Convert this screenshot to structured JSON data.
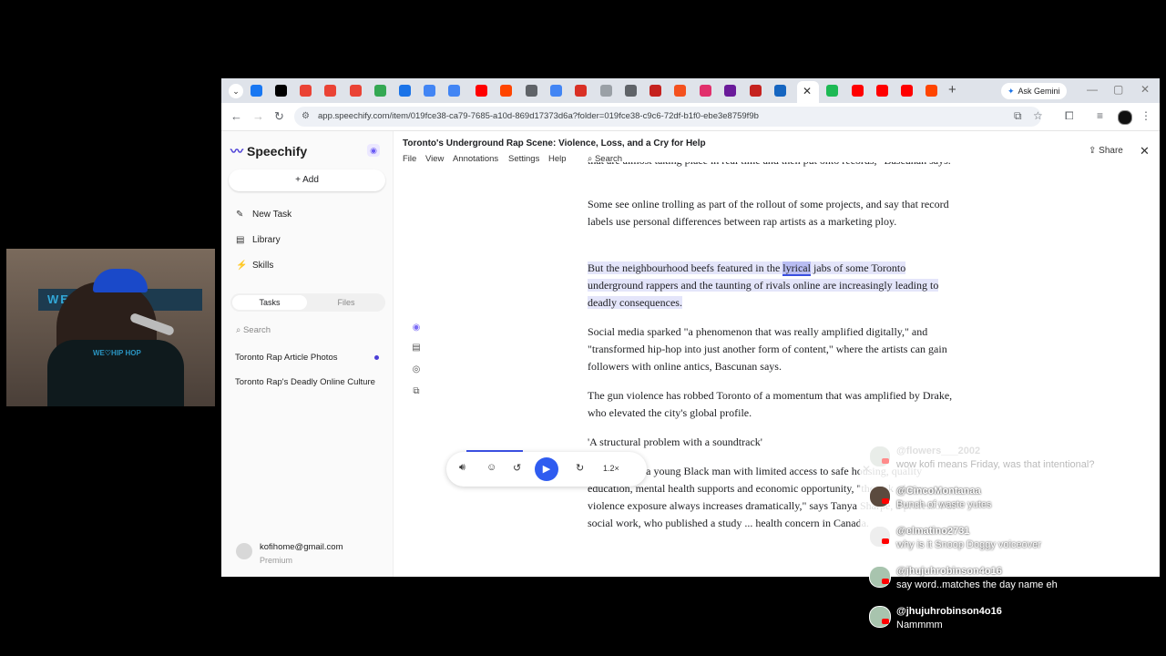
{
  "browser": {
    "tab_colors": [
      "#1877f2",
      "#000000",
      "#ea4335",
      "#ea4335",
      "#ea4335",
      "#34a853",
      "#1a73e8",
      "#4285f4",
      "#4285f4",
      "#ff0000",
      "#ff4500",
      "#5f6368",
      "#4285f4",
      "#d93025",
      "#9aa0a6",
      "#5f6368",
      "#c5221f",
      "#f4511e",
      "#e1306c",
      "#6a1b9a",
      "#c5221f",
      "#1565c0",
      "#1db954",
      "#ff0000",
      "#ff0000",
      "#ff0000",
      "#ff4500"
    ],
    "active_tab_close": "✕",
    "new_tab": "+",
    "ask_gemini": "Ask Gemini",
    "url": "app.speechify.com/item/019fce38-ca79-7685-a10d-869d17373d6a?folder=019fce38-c9c6-72df-b1f0-ebe3e8759f9b",
    "controls": {
      "minimize": "—",
      "maximize": "▢",
      "close": "✕"
    },
    "nav": {
      "back": "←",
      "forward": "→",
      "reload": "↻"
    }
  },
  "sidebar": {
    "logo": "Speechify",
    "add": "Add",
    "items": [
      {
        "label": "New Task",
        "icon": "✎"
      },
      {
        "label": "Library",
        "icon": "▤"
      },
      {
        "label": "Skills",
        "icon": "⚡"
      }
    ],
    "tabs": {
      "tasks": "Tasks",
      "files": "Files"
    },
    "search_placeholder": "Search",
    "tasks": [
      "Toronto Rap Article Photos",
      "Toronto Rap's Deadly Online Culture"
    ],
    "account": {
      "email": "kofihome@gmail.com",
      "plan": "Premium"
    }
  },
  "doc": {
    "title": "Toronto's Underground Rap Scene: Violence, Loss, and a Cry for Help",
    "menu": [
      "File",
      "View",
      "Annotations",
      "Settings",
      "Help"
    ],
    "search": "Search",
    "share": "Share",
    "paragraphs": {
      "p0": "that are almost taking place in real time and then put onto records,\" Bascunan says.",
      "p1": "Some see online trolling as part of the rollout of some projects, and say that record labels use personal differences between rap artists as a marketing ploy.",
      "p2_a": "But the neighbourhood beefs featured in the ",
      "p2_word": "lyrical",
      "p2_b": " jabs of some Toronto underground rappers and the taunting of rivals online are increasingly leading to deadly consequences.",
      "p3": "Social media sparked \"a phenomenon that was really amplified digitally,\" and \"transformed hip-hop into just another form of content,\" where the artists can gain followers with online antics, Bascunan says.",
      "p4": "The gun violence has robbed Toronto of a momentum that was amplified by Drake, who elevated the city's global profile.",
      "p5": "'A structural problem with a soundtrack'",
      "p6": "When you're a young Black man with limited access to safe housing, quality education, mental health supports and economic opportunity, \"the risk of gun violence exposure always increases dramatically,\" says Tanya Sharpe, a professor of social work, who published a study ... health concern in Canada."
    }
  },
  "player": {
    "speed": "1.2×",
    "close": "✕"
  },
  "webcam": {
    "banner": "WE♡HIP HOP",
    "hoodie": "WE♡HIP HOP"
  },
  "chat": [
    {
      "user": "@flowers___2002",
      "text": "wow kofi means Friday, was that intentional?",
      "faded": true
    },
    {
      "user": "@CincoMontanaa",
      "text": "Bunch of waste yutes"
    },
    {
      "user": "@elmatino2731",
      "text": "why is it Snoop Doggy voiceover"
    },
    {
      "user": "@jhujuhrobinson4o16",
      "text": "say word..matches the day name eh"
    },
    {
      "user": "@jhujuhrobinson4o16",
      "text": "Nammmm"
    }
  ]
}
